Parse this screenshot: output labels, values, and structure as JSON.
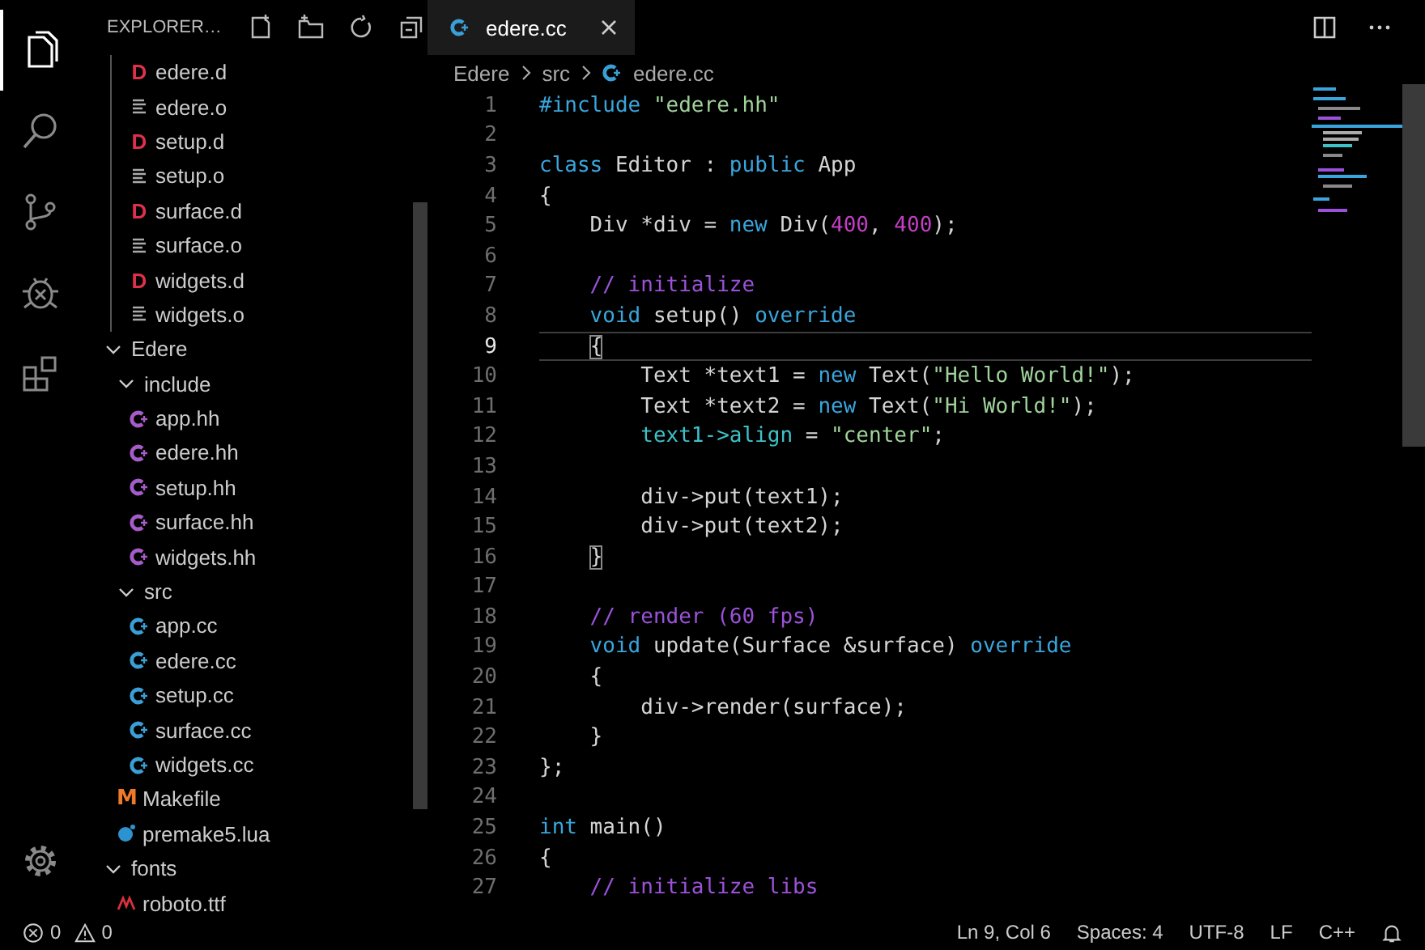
{
  "activity_bar": {
    "items": [
      {
        "kind": "explorer",
        "selected": true
      },
      {
        "kind": "search",
        "selected": false
      },
      {
        "kind": "source-control",
        "selected": false
      },
      {
        "kind": "debug",
        "selected": false
      },
      {
        "kind": "extensions",
        "selected": false
      }
    ],
    "bottom": [
      {
        "kind": "settings"
      }
    ]
  },
  "sidebar": {
    "title": "EXPLORER…",
    "tree": [
      {
        "kind": "group",
        "children": [
          {
            "label": "edere.d",
            "kind": "d",
            "glyph": "D"
          },
          {
            "label": "edere.o",
            "kind": "obj"
          },
          {
            "label": "setup.d",
            "kind": "d",
            "glyph": "D"
          },
          {
            "label": "setup.o",
            "kind": "obj"
          },
          {
            "label": "surface.d",
            "kind": "d",
            "glyph": "D"
          },
          {
            "label": "surface.o",
            "kind": "obj"
          },
          {
            "label": "widgets.d",
            "kind": "d",
            "glyph": "D"
          },
          {
            "label": "widgets.o",
            "kind": "obj"
          }
        ]
      },
      {
        "label": "Edere",
        "kind": "folder",
        "expanded": true,
        "children": [
          {
            "label": "include",
            "kind": "folder",
            "expanded": true,
            "children": [
              {
                "label": "app.hh",
                "kind": "hh"
              },
              {
                "label": "edere.hh",
                "kind": "hh"
              },
              {
                "label": "setup.hh",
                "kind": "hh"
              },
              {
                "label": "surface.hh",
                "kind": "hh"
              },
              {
                "label": "widgets.hh",
                "kind": "hh"
              }
            ]
          },
          {
            "label": "src",
            "kind": "folder",
            "expanded": true,
            "children": [
              {
                "label": "app.cc",
                "kind": "cc"
              },
              {
                "label": "edere.cc",
                "kind": "cc"
              },
              {
                "label": "setup.cc",
                "kind": "cc"
              },
              {
                "label": "surface.cc",
                "kind": "cc"
              },
              {
                "label": "widgets.cc",
                "kind": "cc"
              }
            ]
          },
          {
            "label": "Makefile",
            "kind": "makefile",
            "glyph": "M"
          },
          {
            "label": "premake5.lua",
            "kind": "lua"
          }
        ]
      },
      {
        "label": "fonts",
        "kind": "folder",
        "expanded": true,
        "children": [
          {
            "label": "roboto.ttf",
            "kind": "font"
          }
        ]
      }
    ]
  },
  "editor": {
    "tabs": [
      {
        "label": "edere.cc",
        "kind": "cc",
        "selected": true
      }
    ],
    "breadcrumb": [
      {
        "label": "Edere",
        "kind": "folder"
      },
      {
        "label": "src",
        "kind": "folder"
      },
      {
        "label": "edere.cc",
        "kind": "cc"
      }
    ],
    "lines": [
      {
        "number": "1",
        "current": false,
        "tokens": [
          {
            "kind": "kw",
            "text": "#include"
          },
          {
            "kind": "str",
            "text": " \"edere.hh\""
          }
        ]
      },
      {
        "number": "2",
        "current": false
      },
      {
        "number": "3",
        "current": false,
        "tokens": [
          {
            "kind": "kw",
            "text": "class"
          },
          {
            "kind": "plain",
            "text": " Editor : "
          },
          {
            "kind": "kw",
            "text": "public"
          },
          {
            "kind": "plain",
            "text": " App"
          }
        ]
      },
      {
        "number": "4",
        "current": false,
        "tokens": [
          {
            "kind": "plain",
            "text": "{"
          }
        ]
      },
      {
        "number": "5",
        "current": false,
        "tokens": [
          {
            "kind": "plain",
            "text": "    Div *div = "
          },
          {
            "kind": "kw",
            "text": "new"
          },
          {
            "kind": "plain",
            "text": " Div("
          },
          {
            "kind": "num",
            "text": "400"
          },
          {
            "kind": "plain",
            "text": ", "
          },
          {
            "kind": "num",
            "text": "400"
          },
          {
            "kind": "plain",
            "text": ");"
          }
        ]
      },
      {
        "number": "6",
        "current": false
      },
      {
        "number": "7",
        "current": false,
        "tokens": [
          {
            "kind": "comment",
            "text": "    // initialize"
          }
        ]
      },
      {
        "number": "8",
        "current": false,
        "tokens": [
          {
            "kind": "kw",
            "text": "    void"
          },
          {
            "kind": "plain",
            "text": " setup() "
          },
          {
            "kind": "kw",
            "text": "override"
          }
        ]
      },
      {
        "number": "9",
        "current": true,
        "tokens": [
          {
            "kind": "bracket",
            "text": "    {"
          }
        ]
      },
      {
        "number": "10",
        "current": false,
        "tokens": [
          {
            "kind": "plain",
            "text": "        Text *text1 = "
          },
          {
            "kind": "kw",
            "text": "new"
          },
          {
            "kind": "plain",
            "text": " Text("
          },
          {
            "kind": "str",
            "text": "\"Hello World!\""
          },
          {
            "kind": "plain",
            "text": ");"
          }
        ]
      },
      {
        "number": "11",
        "current": false,
        "tokens": [
          {
            "kind": "plain",
            "text": "        Text *text2 = "
          },
          {
            "kind": "kw",
            "text": "new"
          },
          {
            "kind": "plain",
            "text": " Text("
          },
          {
            "kind": "str",
            "text": "\"Hi World!\""
          },
          {
            "kind": "plain",
            "text": ");"
          }
        ]
      },
      {
        "number": "12",
        "current": false,
        "tokens": [
          {
            "kind": "member",
            "text": "        text1->align"
          },
          {
            "kind": "plain",
            "text": " = "
          },
          {
            "kind": "str",
            "text": "\"center\""
          },
          {
            "kind": "plain",
            "text": ";"
          }
        ]
      },
      {
        "number": "13",
        "current": false
      },
      {
        "number": "14",
        "current": false,
        "tokens": [
          {
            "kind": "plain",
            "text": "        div->put(text1);"
          }
        ]
      },
      {
        "number": "15",
        "current": false,
        "tokens": [
          {
            "kind": "plain",
            "text": "        div->put(text2);"
          }
        ]
      },
      {
        "number": "16",
        "current": false,
        "tokens": [
          {
            "kind": "bracket",
            "text": "    }"
          }
        ]
      },
      {
        "number": "17",
        "current": false
      },
      {
        "number": "18",
        "current": false,
        "tokens": [
          {
            "kind": "comment",
            "text": "    // render (60 fps)"
          }
        ]
      },
      {
        "number": "19",
        "current": false,
        "tokens": [
          {
            "kind": "kw",
            "text": "    void"
          },
          {
            "kind": "plain",
            "text": " update(Surface &surface) "
          },
          {
            "kind": "kw",
            "text": "override"
          }
        ]
      },
      {
        "number": "20",
        "current": false,
        "tokens": [
          {
            "kind": "plain",
            "text": "    {"
          }
        ]
      },
      {
        "number": "21",
        "current": false,
        "tokens": [
          {
            "kind": "plain",
            "text": "        div->render(surface);"
          }
        ]
      },
      {
        "number": "22",
        "current": false,
        "tokens": [
          {
            "kind": "plain",
            "text": "    }"
          }
        ]
      },
      {
        "number": "23",
        "current": false,
        "tokens": [
          {
            "kind": "plain",
            "text": "};"
          }
        ]
      },
      {
        "number": "24",
        "current": false
      },
      {
        "number": "25",
        "current": false,
        "tokens": [
          {
            "kind": "kw",
            "text": "int"
          },
          {
            "kind": "plain",
            "text": " main()"
          }
        ]
      },
      {
        "number": "26",
        "current": false,
        "tokens": [
          {
            "kind": "plain",
            "text": "{"
          }
        ]
      },
      {
        "number": "27",
        "current": false,
        "tokens": [
          {
            "kind": "comment",
            "text": "    // initialize libs"
          }
        ]
      }
    ]
  },
  "status_bar": {
    "left": [
      {
        "kind": "errors",
        "text": "0"
      },
      {
        "kind": "warnings",
        "text": "0"
      }
    ],
    "right": [
      {
        "text": "Ln 9, Col 6"
      },
      {
        "text": "Spaces: 4"
      },
      {
        "text": "UTF-8"
      },
      {
        "text": "LF"
      },
      {
        "text": "C++"
      }
    ]
  }
}
